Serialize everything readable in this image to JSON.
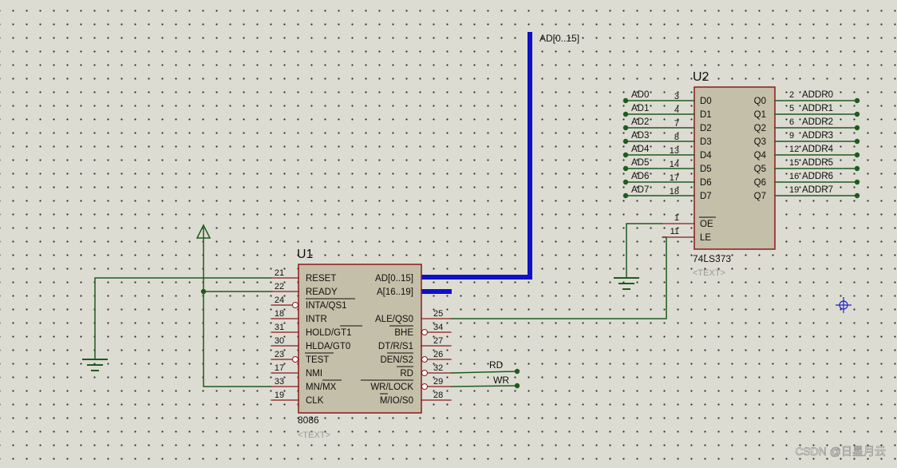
{
  "u1": {
    "ref": "U1",
    "part": "8086",
    "text_placeholder": "<TEXT>",
    "left_pins": [
      {
        "num": "21",
        "name": "RESET",
        "inv": false
      },
      {
        "num": "22",
        "name": "READY",
        "inv": false
      },
      {
        "num": "24",
        "name": "INTA/QS1",
        "inv": true
      },
      {
        "num": "18",
        "name": "INTR",
        "inv": false
      },
      {
        "num": "31",
        "name": "HOLD/GT1",
        "inv": false
      },
      {
        "num": "30",
        "name": "HLDA/GT0",
        "inv": false
      },
      {
        "num": "23",
        "name": "TEST",
        "inv": true
      },
      {
        "num": "17",
        "name": "NMI",
        "inv": false
      },
      {
        "num": "33",
        "name": "MN/MX",
        "inv": false
      },
      {
        "num": "19",
        "name": "CLK",
        "inv": false
      }
    ],
    "bus_pins": [
      {
        "name": "AD[0..15]"
      },
      {
        "name": "A[16..19]"
      }
    ],
    "right_pins": [
      {
        "num": "25",
        "name": "ALE/QS0",
        "inv": false
      },
      {
        "num": "34",
        "name": "BHE",
        "inv": true
      },
      {
        "num": "27",
        "name": "DT/R/S1",
        "inv": false
      },
      {
        "num": "26",
        "name": "DEN/S2",
        "inv": true
      },
      {
        "num": "32",
        "name": "RD",
        "inv": true
      },
      {
        "num": "29",
        "name": "WR/LOCK",
        "inv": true
      },
      {
        "num": "28",
        "name": "M/IO/S0",
        "inv": false
      }
    ]
  },
  "u2": {
    "ref": "U2",
    "part": "74LS373",
    "text_placeholder": "<TEXT>",
    "inputs": [
      {
        "num": "3",
        "name": "D0",
        "net": "AD0"
      },
      {
        "num": "4",
        "name": "D1",
        "net": "AD1"
      },
      {
        "num": "7",
        "name": "D2",
        "net": "AD2"
      },
      {
        "num": "8",
        "name": "D3",
        "net": "AD3"
      },
      {
        "num": "13",
        "name": "D4",
        "net": "AD4"
      },
      {
        "num": "14",
        "name": "D5",
        "net": "AD5"
      },
      {
        "num": "17",
        "name": "D6",
        "net": "AD6"
      },
      {
        "num": "18",
        "name": "D7",
        "net": "AD7"
      }
    ],
    "outputs": [
      {
        "num": "2",
        "name": "Q0",
        "net": "ADDR0"
      },
      {
        "num": "5",
        "name": "Q1",
        "net": "ADDR1"
      },
      {
        "num": "6",
        "name": "Q2",
        "net": "ADDR2"
      },
      {
        "num": "9",
        "name": "Q3",
        "net": "ADDR3"
      },
      {
        "num": "12",
        "name": "Q4",
        "net": "ADDR4"
      },
      {
        "num": "15",
        "name": "Q5",
        "net": "ADDR5"
      },
      {
        "num": "16",
        "name": "Q6",
        "net": "ADDR6"
      },
      {
        "num": "19",
        "name": "Q7",
        "net": "ADDR7"
      }
    ],
    "control": [
      {
        "num": "1",
        "name": "OE"
      },
      {
        "num": "11",
        "name": "LE"
      }
    ]
  },
  "nets": {
    "bus_label": "AD[0..15]",
    "rd": "RD",
    "wr": "WR"
  },
  "watermark": "CSDN @日星月云",
  "colors": {
    "wire": "#1f5a1f",
    "bus": "#1010c8",
    "body": "#c4bfa8",
    "outline": "#8b1a1a",
    "marker": "#2020d0"
  }
}
